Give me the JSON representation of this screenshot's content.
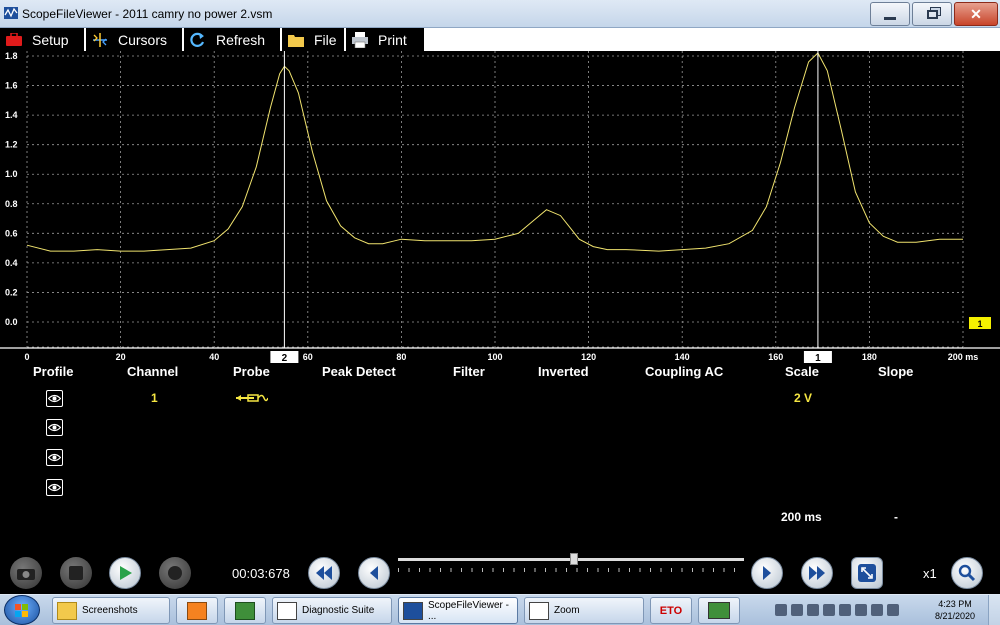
{
  "window": {
    "title": "ScopeFileViewer - 2011 camry no power 2.vsm"
  },
  "toolbar": {
    "setup": "Setup",
    "cursors": "Cursors",
    "refresh": "Refresh",
    "file": "File",
    "print": "Print"
  },
  "scope": {
    "y_ticks": [
      "1.8",
      "1.6",
      "1.4",
      "1.2",
      "1.0",
      "0.8",
      "0.6",
      "0.4",
      "0.2",
      "0.0"
    ],
    "x_ticks": [
      "0",
      "20",
      "40",
      "60",
      "80",
      "100",
      "120",
      "140",
      "160",
      "180",
      "200 ms"
    ],
    "cursor1_label": "2",
    "cursor2_label": "1",
    "channel_marker": "1",
    "trace_color": "#f0e36e",
    "cursor_positions_ms": [
      55,
      169
    ],
    "ylim": [
      0,
      1.8
    ],
    "xlim_ms": [
      0,
      200
    ]
  },
  "chart_data": {
    "type": "line",
    "title": "",
    "xlabel": "",
    "ylabel": "",
    "xlim": [
      0,
      200
    ],
    "ylim": [
      0,
      1.8
    ],
    "grid": true,
    "series": [
      {
        "x": [
          0,
          5,
          10,
          15,
          20,
          25,
          30,
          35,
          40,
          43,
          46,
          49,
          52,
          54,
          55,
          56,
          58,
          61,
          64,
          67,
          70,
          73,
          76,
          80,
          85,
          90,
          95,
          100,
          105,
          108,
          111,
          114,
          116,
          118,
          121,
          124,
          128,
          135,
          140,
          145,
          150,
          155,
          158,
          161,
          164,
          167,
          169,
          171,
          174,
          177,
          180,
          183,
          186,
          190,
          195,
          200
        ],
        "y": [
          0.52,
          0.48,
          0.48,
          0.49,
          0.48,
          0.48,
          0.49,
          0.5,
          0.55,
          0.63,
          0.78,
          1.05,
          1.45,
          1.68,
          1.73,
          1.7,
          1.55,
          1.15,
          0.82,
          0.65,
          0.57,
          0.53,
          0.53,
          0.56,
          0.55,
          0.55,
          0.55,
          0.56,
          0.6,
          0.68,
          0.76,
          0.72,
          0.64,
          0.56,
          0.51,
          0.49,
          0.49,
          0.48,
          0.49,
          0.5,
          0.53,
          0.62,
          0.78,
          1.08,
          1.45,
          1.76,
          1.82,
          1.7,
          1.3,
          0.88,
          0.67,
          0.58,
          0.54,
          0.54,
          0.56,
          0.56
        ]
      }
    ]
  },
  "columns": {
    "profile": "Profile",
    "channel": "Channel",
    "probe": "Probe",
    "peak_detect": "Peak Detect",
    "filter": "Filter",
    "inverted": "Inverted",
    "coupling": "Coupling AC",
    "scale": "Scale",
    "slope": "Slope"
  },
  "row1": {
    "channel": "1",
    "scale": "2 V"
  },
  "status": {
    "timebase": "200 ms",
    "slope_value": "-"
  },
  "playback": {
    "timecode": "00:03:678",
    "zoom": "x1",
    "position": 0.51
  },
  "taskbar": {
    "items": [
      "Screenshots",
      "Diagnostic Suite",
      "ScopeFileViewer - ...",
      "Zoom"
    ],
    "eto_label": "ETO",
    "time": "4:23 PM",
    "date": "8/21/2020"
  }
}
